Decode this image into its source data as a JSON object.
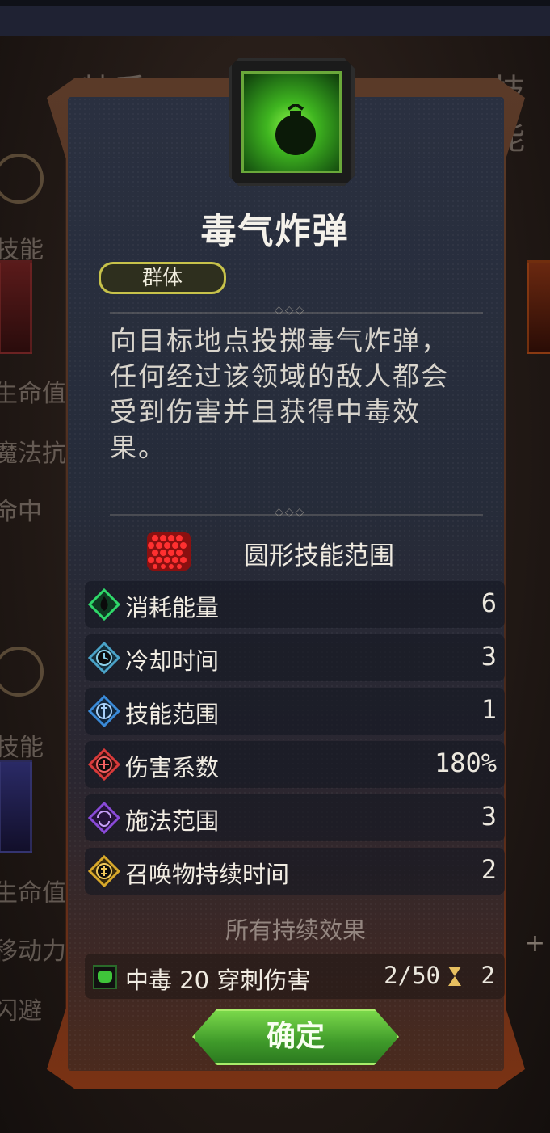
{
  "background": {
    "tabs": [
      "特质",
      "技能"
    ],
    "left_texts": [
      "技能",
      "生命值",
      "魔法抗",
      "命中",
      "技能",
      "生命值",
      "移动力",
      "闪避"
    ],
    "plus": "+"
  },
  "skill": {
    "icon": "poison-bomb-icon",
    "title": "毒气炸弹",
    "tag": "群体",
    "description": "向目标地点投掷毒气炸弹，任何经过该领域的敌人都会受到伤害并且获得中毒效果。",
    "description_lines": [
      "向目标地点投掷毒气炸弹，",
      "任何经过该领域的敌人都会",
      "受到伤害并且获得中毒效",
      "果。"
    ],
    "range_label": "圆形技能范围"
  },
  "stats": [
    {
      "label": "消耗能量",
      "value": "6",
      "icon": "energy-icon",
      "color": "#2fd86a"
    },
    {
      "label": "冷却时间",
      "value": "3",
      "icon": "cooldown-icon",
      "color": "#4aa3c8"
    },
    {
      "label": "技能范围",
      "value": "1",
      "icon": "skill-range-icon",
      "color": "#3a8ad8"
    },
    {
      "label": "伤害系数",
      "value": "180%",
      "icon": "damage-icon",
      "color": "#d83a3a"
    },
    {
      "label": "施法范围",
      "value": "3",
      "icon": "cast-range-icon",
      "color": "#8a4ad8"
    },
    {
      "label": "召唤物持续时间",
      "value": "2",
      "icon": "summon-duration-icon",
      "color": "#d8a82a"
    }
  ],
  "effects": {
    "heading": "所有持续效果",
    "items": [
      {
        "name": "中毒  20 穿刺伤害",
        "stack": "2/50",
        "turns": "2",
        "icon": "poison-icon"
      }
    ]
  },
  "confirm_label": "确定"
}
